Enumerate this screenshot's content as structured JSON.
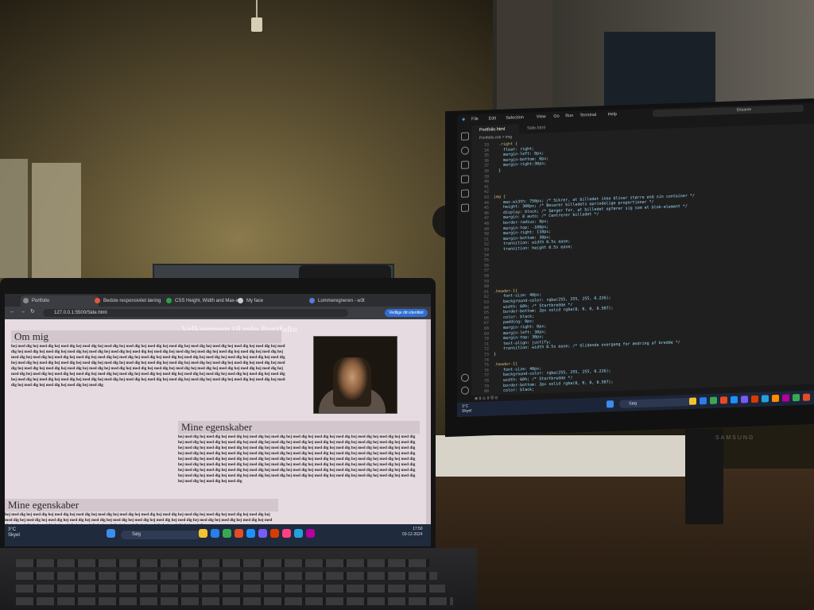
{
  "laptop": {
    "browser": {
      "tabs": [
        {
          "label": "Portfolio",
          "active": true,
          "color": "#8a8a8a"
        },
        {
          "label": "Bedste responsivitet læring",
          "active": false,
          "color": "#e25a3a"
        },
        {
          "label": "CSS Height, Width and Max-w...",
          "active": false,
          "color": "#2f9e44"
        },
        {
          "label": "My face",
          "active": false,
          "color": "#cccccc"
        },
        {
          "label": "Lommeregneren - w3t",
          "active": false,
          "color": "#5a7adb"
        }
      ],
      "url": "127.0.0.1:5500/Side.html",
      "update_button": "Vedlige din identitet"
    },
    "page": {
      "title": "Velkommen til min Portfolio",
      "sections": [
        {
          "heading": "Om mig",
          "text": "hej med dig hej med dig hej med dig hej med dig hej med dig hej med dig hej med dig hej med dig hej med dig hej med dig hej med dig hej med dig hej med dig hej med dig hej med dig hej med dig hej med dig hej med dig hej med dig hej med dig hej med dig hej med dig hej med dig hej med dig hej med dig hej med dig hej med dig hej med dig hej med dig hej med dig hej med dig hej med dig hej med dig hej med dig hej med dig hej med dig hej med dig hej med dig hej med dig hej med dig hej med dig hej med dig hej med dig hej med dig hej med dig hej med dig hej med dig hej med dig hej med dig hej med dig hej med dig hej med dig hej med dig hej med dig hej med dig hej med dig hej med dig hej med dig hej med dig hej med dig hej med dig hej med dig hej med dig hej med dig hej med dig hej med dig hej med dig hej med dig hej med dig hej med dig hej med dig hej med dig hej med dig hej med dig hej med dig hej med dig hej med dig hej med dig hej med dig hej med dig hej med dig hej med dig hej med dig hej med dig hej med dig hej med dig hej med dig hej med dig hej med dig hej med dig hej med dig hej med dig hej med dig"
        },
        {
          "heading": "Mine egenskaber",
          "text": "hej med dig hej med dig hej med dig hej med dig hej med dig hej med dig hej med dig hej med dig hej med dig hej med dig hej med dig hej med dig hej med dig hej med dig hej med dig hej med dig hej med dig hej med dig hej med dig hej med dig hej med dig hej med dig hej med dig hej med dig hej med dig hej med dig hej med dig hej med dig hej med dig hej med dig hej med dig hej med dig hej med dig hej med dig hej med dig hej med dig hej med dig hej med dig hej med dig hej med dig hej med dig hej med dig hej med dig hej med dig hej med dig hej med dig hej med dig hej med dig hej med dig hej med dig hej med dig hej med dig hej med dig hej med dig hej med dig hej med dig hej med dig hej med dig hej med dig hej med dig hej med dig hej med dig hej med dig hej med dig hej med dig hej med dig hej med dig hej med dig hej med dig hej med dig hej med dig hej med dig hej med dig hej med dig hej med dig hej med dig hej med dig hej med dig hej med dig hej med dig hej med dig hej med dig hej med dig hej med dig hej med dig hej med dig hej med dig hej med dig hej med dig hej med dig hej med dig"
        },
        {
          "heading": "Mine egenskaber",
          "text": "hej med dig hej med dig hej med dig hej med dig hej med dig hej med dig hej med dig hej med dig hej med dig hej med dig hej med dig hej med dig hej med dig hej med dig hej med dig hej med dig hej med dig hej med dig hej med dig hej med dig hej med dig hej med dig hej med dig hej med dig hej med dig hej med dig hej med dig hej med dig hej med dig hej med dig hej med dig hej med dig hej med dig hej med dig"
        }
      ]
    },
    "taskbar": {
      "weather_temp": "3°C",
      "weather_desc": "Skyet",
      "search": "Søg",
      "time": "17:50",
      "date": "03-12-2024",
      "icon_colors": [
        "#f4c430",
        "#2b7de9",
        "#3aa757",
        "#e34c26",
        "#1e90ff",
        "#7a5af8",
        "#d83b01",
        "#ff4081",
        "#25a0da",
        "#b4009e"
      ]
    }
  },
  "monitor": {
    "brand": "SAMSUNG",
    "vscode": {
      "menu": [
        "File",
        "Edit",
        "Selection",
        "View",
        "Go",
        "Run",
        "Terminal",
        "Help"
      ],
      "search": "Eksame",
      "tabs": [
        {
          "label": "Portfolio.html",
          "active": true
        },
        {
          "label": "Side.html",
          "active": false
        }
      ],
      "breadcrumb": "Portfolio.css > img",
      "status": "⊗ 0 ⚠ 0   ⓦ 0",
      "code_lines": [
        {
          "n": "33",
          "t": "  .right {",
          "c": "#d7ba7d"
        },
        {
          "n": "34",
          "t": "    float: right;",
          "c": "#9cdcfe"
        },
        {
          "n": "35",
          "t": "    margin-left: 0px;",
          "c": "#9cdcfe"
        },
        {
          "n": "36",
          "t": "    margin-bottom: 0px;",
          "c": "#9cdcfe"
        },
        {
          "n": "37",
          "t": "    margin-right:30px;",
          "c": "#9cdcfe"
        },
        {
          "n": "38",
          "t": "  }",
          "c": "#d4d4d4"
        },
        {
          "n": "39",
          "t": "",
          "c": "#d4d4d4"
        },
        {
          "n": "40",
          "t": "",
          "c": "#d4d4d4"
        },
        {
          "n": "41",
          "t": "",
          "c": "#d4d4d4"
        },
        {
          "n": "42",
          "t": "",
          "c": "#d4d4d4"
        },
        {
          "n": "43",
          "t": "img {",
          "c": "#d7ba7d"
        },
        {
          "n": "44",
          "t": "    max-width: 750px; /* Sikrer, at billedet ikke bliver større end sin container */",
          "c": "#9cdcfe"
        },
        {
          "n": "45",
          "t": "    height: 300px; /* Bevarer billedets oprindelige proportioner */",
          "c": "#9cdcfe"
        },
        {
          "n": "46",
          "t": "    display: block; /* Sørger for, at billedet opfører sig som et blok-element */",
          "c": "#9cdcfe"
        },
        {
          "n": "47",
          "t": "    margin: 0 auto; /* Centrerer billedet */",
          "c": "#9cdcfe"
        },
        {
          "n": "48",
          "t": "    border-radius: 8px;",
          "c": "#9cdcfe"
        },
        {
          "n": "49",
          "t": "    margin-top: -100px;",
          "c": "#9cdcfe"
        },
        {
          "n": "50",
          "t": "    margin-right: 110px;",
          "c": "#9cdcfe"
        },
        {
          "n": "51",
          "t": "    margin-bottom: 30px;",
          "c": "#9cdcfe"
        },
        {
          "n": "52",
          "t": "    transition: width 0.5s ease;",
          "c": "#9cdcfe"
        },
        {
          "n": "53",
          "t": "    transition: height 0.5s ease;",
          "c": "#9cdcfe"
        },
        {
          "n": "54",
          "t": "",
          "c": "#d4d4d4"
        },
        {
          "n": "55",
          "t": "",
          "c": "#d4d4d4"
        },
        {
          "n": "56",
          "t": "",
          "c": "#d4d4d4"
        },
        {
          "n": "57",
          "t": "",
          "c": "#d4d4d4"
        },
        {
          "n": "58",
          "t": "",
          "c": "#d4d4d4"
        },
        {
          "n": "59",
          "t": "",
          "c": "#d4d4d4"
        },
        {
          "n": "60",
          "t": "",
          "c": "#d4d4d4"
        },
        {
          "n": "61",
          "t": ".header-1{",
          "c": "#d7ba7d"
        },
        {
          "n": "62",
          "t": "    font-size: 40px;",
          "c": "#9cdcfe"
        },
        {
          "n": "63",
          "t": "    background-color: rgba(255, 255, 255, 0.226);",
          "c": "#9cdcfe"
        },
        {
          "n": "64",
          "t": "    width: 60%; /* Startbredde */",
          "c": "#9cdcfe"
        },
        {
          "n": "65",
          "t": "    border-bottom: 2px solid rgba(0, 0, 0, 0.507);",
          "c": "#9cdcfe"
        },
        {
          "n": "66",
          "t": "    color: black;",
          "c": "#9cdcfe"
        },
        {
          "n": "67",
          "t": "    padding: 0px;",
          "c": "#9cdcfe"
        },
        {
          "n": "68",
          "t": "    margin-right: 0px;",
          "c": "#9cdcfe"
        },
        {
          "n": "69",
          "t": "    margin-left: 30px;",
          "c": "#9cdcfe"
        },
        {
          "n": "70",
          "t": "    margin-top: 30px;",
          "c": "#9cdcfe"
        },
        {
          "n": "71",
          "t": "    text-align: justify;",
          "c": "#9cdcfe"
        },
        {
          "n": "72",
          "t": "    transition: width 0.5s ease; /* Glidende overgang for ændring af bredde */",
          "c": "#9cdcfe"
        },
        {
          "n": "73",
          "t": "}",
          "c": "#d4d4d4"
        },
        {
          "n": "74",
          "t": "",
          "c": "#d4d4d4"
        },
        {
          "n": "75",
          "t": ".header-1{",
          "c": "#d7ba7d"
        },
        {
          "n": "76",
          "t": "    font-size: 40px;",
          "c": "#9cdcfe"
        },
        {
          "n": "77",
          "t": "    background-color: rgba(255, 255, 255, 0.226);",
          "c": "#9cdcfe"
        },
        {
          "n": "78",
          "t": "    width: 60%; /* Startbredde */",
          "c": "#9cdcfe"
        },
        {
          "n": "79",
          "t": "    border-bottom: 2px solid rgba(0, 0, 0, 0.507);",
          "c": "#9cdcfe"
        },
        {
          "n": "80",
          "t": "    color: black;",
          "c": "#9cdcfe"
        },
        {
          "n": "81",
          "t": "    padding: 0px;",
          "c": "#9cdcfe"
        }
      ]
    },
    "taskbar": {
      "weather_temp": "3°C",
      "weather_desc": "Skyet",
      "search": "Søg",
      "icon_colors": [
        "#f4c430",
        "#2b7de9",
        "#3aa757",
        "#e34c26",
        "#1e90ff",
        "#7a5af8",
        "#d83b01",
        "#25a0da",
        "#ff8c00",
        "#b4009e",
        "#3aa757",
        "#e34c26"
      ]
    }
  }
}
